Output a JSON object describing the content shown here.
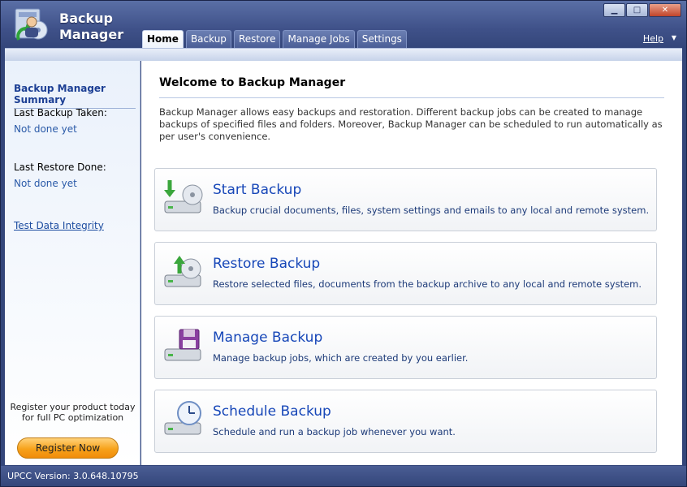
{
  "app": {
    "title_line1": "Backup",
    "title_line2": "Manager"
  },
  "tabs": [
    {
      "label": "Home",
      "active": true
    },
    {
      "label": "Backup"
    },
    {
      "label": "Restore"
    },
    {
      "label": "Manage Jobs"
    },
    {
      "label": "Settings"
    }
  ],
  "header": {
    "help_label": "Help"
  },
  "sidebar": {
    "title": "Backup Manager Summary",
    "last_backup_label": "Last Backup Taken:",
    "last_backup_value": "Not done yet",
    "last_restore_label": "Last Restore Done:",
    "last_restore_value": "Not done yet",
    "integrity_link": "Test Data Integrity",
    "promo_line1": "Register your product today",
    "promo_line2": "for full PC optimization",
    "register_button": "Register Now"
  },
  "main": {
    "title": "Welcome to Backup Manager",
    "description": "Backup Manager allows easy backups and restoration. Different backup jobs can be created to manage backups of specified files and folders. Moreover, Backup Manager can be scheduled to run automatically as per user's convenience.",
    "cards": [
      {
        "title": "Start Backup",
        "desc": "Backup crucial documents, files, system settings and emails to any local and remote system.",
        "icon": "start-backup-icon"
      },
      {
        "title": "Restore Backup",
        "desc": "Restore selected files, documents from the backup archive to any local and remote system.",
        "icon": "restore-backup-icon"
      },
      {
        "title": "Manage Backup",
        "desc": "Manage backup jobs, which are created by you earlier.",
        "icon": "manage-backup-icon"
      },
      {
        "title": "Schedule Backup",
        "desc": "Schedule and run a backup job whenever you want.",
        "icon": "schedule-backup-icon"
      }
    ]
  },
  "status": {
    "version": "UPCC Version: 3.0.648.10795"
  },
  "colors": {
    "accent": "#1747b8",
    "frame": "#34467a",
    "button_orange": "#f7a21b"
  }
}
